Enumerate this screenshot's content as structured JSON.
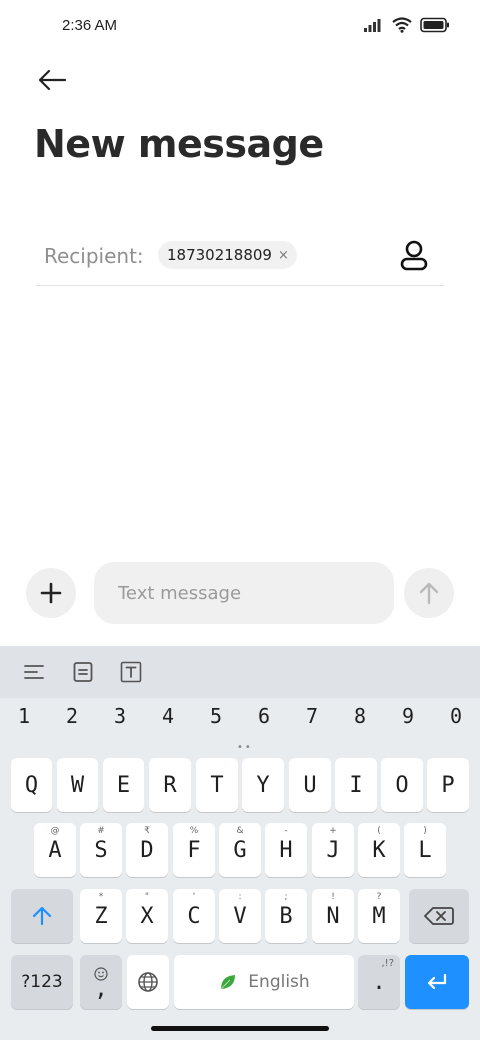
{
  "status_bar": {
    "time": "2:36 AM"
  },
  "header": {
    "title": "New message"
  },
  "recipient": {
    "label": "Recipient:",
    "chip_value": "18730218809",
    "chip_remove": "×"
  },
  "compose": {
    "placeholder": "Text message"
  },
  "keyboard": {
    "numbers": [
      "1",
      "2",
      "3",
      "4",
      "5",
      "6",
      "7",
      "8",
      "9",
      "0"
    ],
    "row1": [
      "Q",
      "W",
      "E",
      "R",
      "T",
      "Y",
      "U",
      "I",
      "O",
      "P"
    ],
    "row2": [
      {
        "key": "A",
        "sub": "@"
      },
      {
        "key": "S",
        "sub": "#"
      },
      {
        "key": "D",
        "sub": "₹"
      },
      {
        "key": "F",
        "sub": "%"
      },
      {
        "key": "G",
        "sub": "&"
      },
      {
        "key": "H",
        "sub": "-"
      },
      {
        "key": "J",
        "sub": "+"
      },
      {
        "key": "K",
        "sub": "("
      },
      {
        "key": "L",
        "sub": ")"
      }
    ],
    "row3": [
      {
        "key": "Z",
        "sub": "*"
      },
      {
        "key": "X",
        "sub": "\""
      },
      {
        "key": "C",
        "sub": "'"
      },
      {
        "key": "V",
        "sub": ":"
      },
      {
        "key": "B",
        "sub": ";"
      },
      {
        "key": "N",
        "sub": "!"
      },
      {
        "key": "M",
        "sub": "?"
      }
    ],
    "symbols_label": "?123",
    "comma_label": ",",
    "space_label": "English",
    "period_label": ".",
    "period_sub": ",!?"
  },
  "colors": {
    "accent": "#1e90ff",
    "keyboard_bg": "#e9ecef"
  }
}
